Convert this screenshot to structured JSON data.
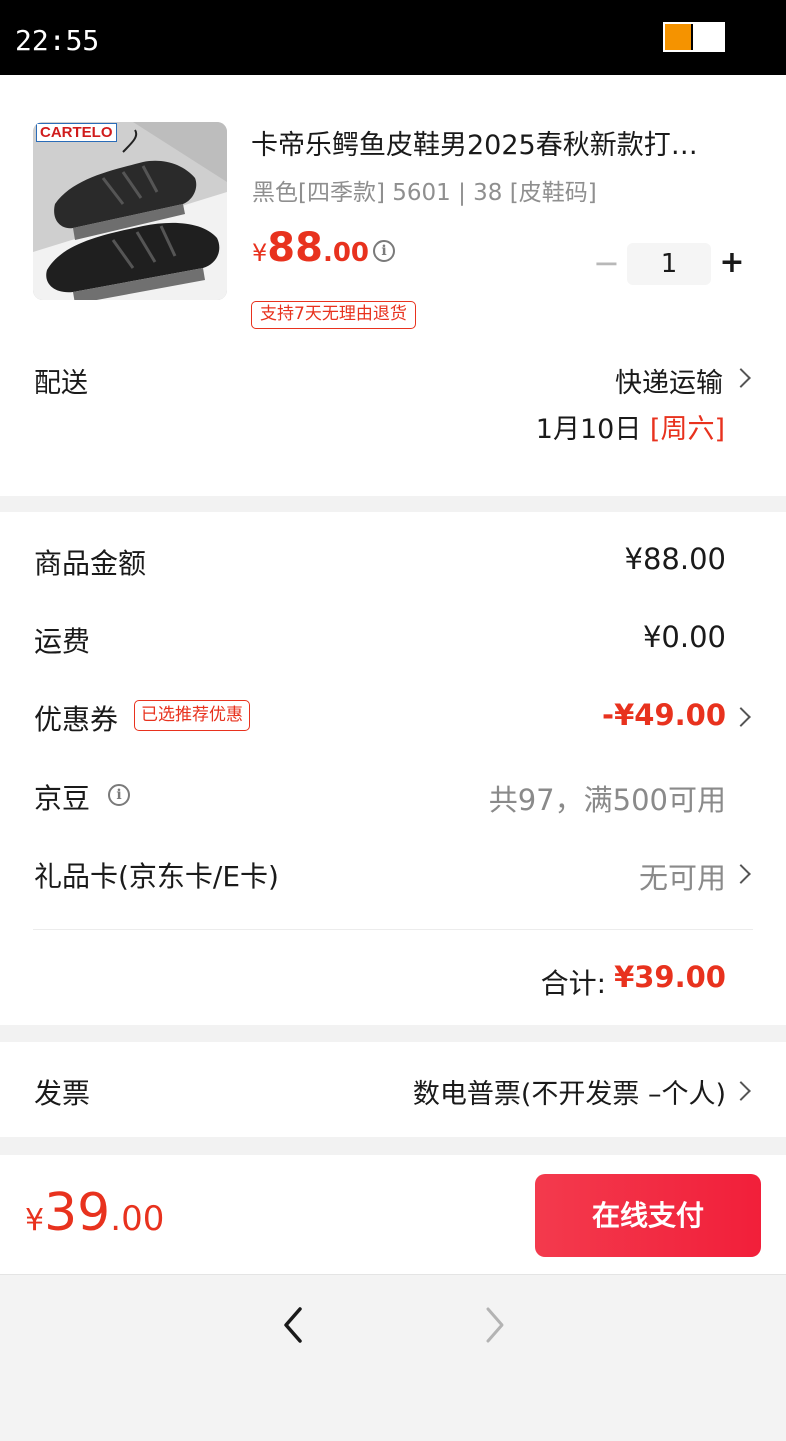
{
  "status_bar": {
    "time": "22:55",
    "battery_color": "#f59300"
  },
  "product": {
    "brand_logo": "CARTELO",
    "title": "卡帝乐鳄鱼皮鞋男2025春秋新款打…",
    "spec": "黑色[四季款] 5601 | 38 [皮鞋码]",
    "price_symbol": "¥",
    "price_int": "88",
    "price_dec": ".00",
    "quantity": "1",
    "minus": "−",
    "plus": "+",
    "return_policy": "支持7天无理由退货"
  },
  "delivery": {
    "label": "配送",
    "method": "快递运输",
    "date": "1月10日",
    "weekday": "[周六]"
  },
  "amounts": {
    "goods_label": "商品金额",
    "goods_value": "¥88.00",
    "shipping_label": "运费",
    "shipping_value": "¥0.00",
    "coupon_label": "优惠券",
    "coupon_tag": "已选推荐优惠",
    "coupon_value": "-¥49.00",
    "jingdou_label": "京豆",
    "jingdou_value": "共97，满500可用",
    "giftcard_label": "礼品卡(京东卡/E卡)",
    "giftcard_value": "无可用",
    "total_label": "合计:",
    "total_value": "¥39.00"
  },
  "invoice": {
    "label": "发票",
    "value": "数电普票(不开发票 –个人)"
  },
  "footer": {
    "price_symbol": "¥",
    "price_int": "39",
    "price_dec": ".00",
    "pay_button": "在线支付"
  },
  "icons": [
    "info-icon",
    "chevron-right-icon",
    "back-icon",
    "forward-icon"
  ],
  "colors": {
    "accent_red": "#e8321e",
    "pay_button": "#f2243d"
  }
}
